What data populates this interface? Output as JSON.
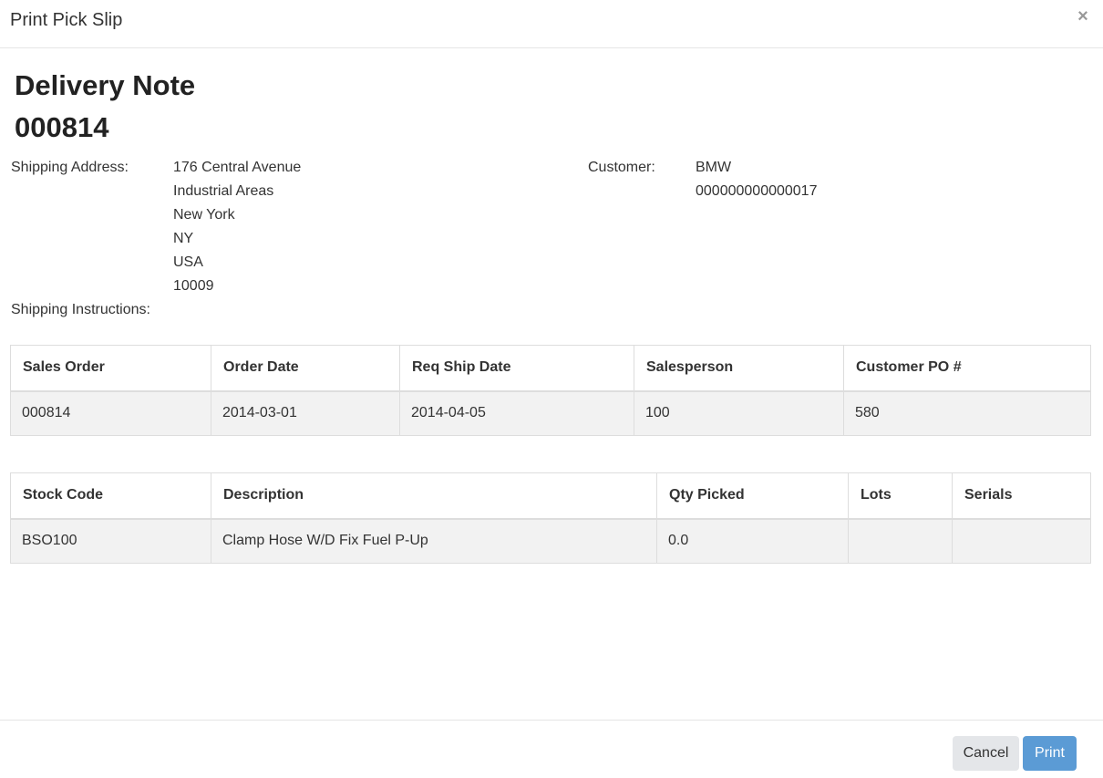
{
  "modal": {
    "title": "Print Pick Slip",
    "close_label": "×"
  },
  "document": {
    "title": "Delivery Note",
    "number": "000814"
  },
  "shipping": {
    "address_label": "Shipping Address:",
    "address_lines": [
      "176 Central Avenue",
      "Industrial Areas",
      "New York",
      "NY",
      "USA",
      "10009"
    ],
    "instructions_label": "Shipping Instructions:",
    "instructions_value": ""
  },
  "customer": {
    "label": "Customer:",
    "name": "BMW",
    "code": "000000000000017"
  },
  "order_table": {
    "headers": [
      "Sales Order",
      "Order Date",
      "Req Ship Date",
      "Salesperson",
      "Customer PO #"
    ],
    "rows": [
      [
        "000814",
        "2014-03-01",
        "2014-04-05",
        "100",
        "580"
      ]
    ]
  },
  "items_table": {
    "headers": [
      "Stock Code",
      "Description",
      "Qty Picked",
      "Lots",
      "Serials"
    ],
    "rows": [
      [
        "BSO100",
        "Clamp Hose W/D Fix Fuel P-Up",
        "0.0",
        "",
        ""
      ]
    ]
  },
  "footer": {
    "cancel_label": "Cancel",
    "print_label": "Print"
  },
  "colors": {
    "primary": "#5b9bd5",
    "secondary": "#e4e6e9",
    "row_bg": "#f2f2f2",
    "border": "#dddddd"
  }
}
